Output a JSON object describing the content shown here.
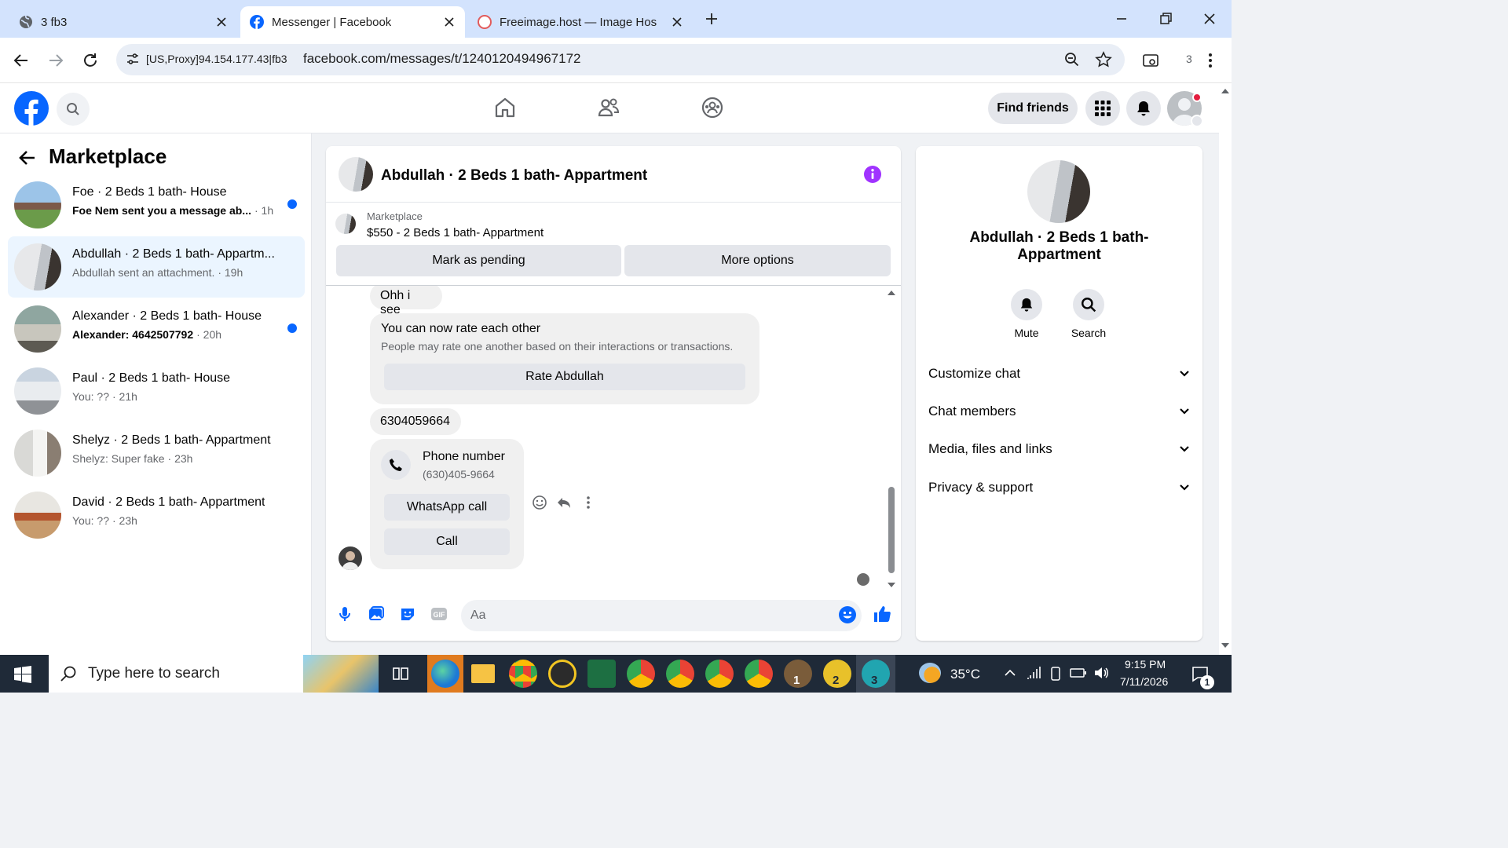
{
  "browser": {
    "tabs": [
      {
        "title": "3 fb3",
        "icon": "globe-icon"
      },
      {
        "title": "Messenger | Facebook",
        "icon": "facebook-icon"
      },
      {
        "title": "Freeimage.host — Image Hostin",
        "icon": "freeimage-icon"
      }
    ],
    "proxy_label": "[US,Proxy]94.154.177.43|fb3",
    "url": "facebook.com/messages/t/1240120494967172",
    "extension_count": "3"
  },
  "header": {
    "find_friends": "Find friends"
  },
  "sidebar": {
    "title": "Marketplace",
    "conversations": [
      {
        "name": "Foe · 2 Beds 1 bath- House",
        "preview": "Foe Nem sent you a message ab...",
        "time": "· 1h",
        "unread": true
      },
      {
        "name": "Abdullah · 2 Beds 1 bath- Appartm...",
        "preview": "Abdullah sent an attachment.",
        "time": "· 19h",
        "unread": false
      },
      {
        "name": "Alexander · 2 Beds 1 bath- House",
        "preview": "Alexander: 4642507792",
        "time": "· 20h",
        "unread": true
      },
      {
        "name": "Paul · 2 Beds 1 bath- House",
        "preview": "You: ??",
        "time": "· 21h",
        "unread": false
      },
      {
        "name": "Shelyz · 2 Beds 1 bath- Appartment",
        "preview": "Shelyz: Super fake",
        "time": "· 23h",
        "unread": false
      },
      {
        "name": "David · 2 Beds 1 bath- Appartment",
        "preview": "You: ??",
        "time": "· 23h",
        "unread": false
      }
    ]
  },
  "chat": {
    "title": "Abdullah · 2 Beds 1 bath- Appartment",
    "marketplace_label": "Marketplace",
    "listing": "$550 - 2 Beds 1 bath- Appartment",
    "mark_pending": "Mark as pending",
    "more_options": "More options",
    "messages": {
      "m1": "Ohh i see",
      "rate_title": "You can now rate each other",
      "rate_sub": "People may rate one another based on their interactions or transactions.",
      "rate_button": "Rate Abdullah",
      "m2": "6304059664",
      "phone_title": "Phone number",
      "phone_value": "(630)405-9664",
      "whatsapp_call": "WhatsApp call",
      "call": "Call"
    },
    "composer_placeholder": "Aa"
  },
  "details": {
    "name_line1": "Abdullah · 2 Beds 1 bath-",
    "name_line2": "Appartment",
    "mute": "Mute",
    "search": "Search",
    "sections": [
      "Customize chat",
      "Chat members",
      "Media, files and links",
      "Privacy & support"
    ]
  },
  "taskbar": {
    "search_placeholder": "Type here to search",
    "weather": "35°C",
    "time": "9:15 PM",
    "date": "7/11/2026",
    "notification_count": "1",
    "profile_badges": [
      "1",
      "2",
      "3"
    ]
  },
  "colors": {
    "facebook_blue": "#0866ff",
    "messenger_purple": "#a033ff",
    "active_row": "#ebf5ff"
  }
}
